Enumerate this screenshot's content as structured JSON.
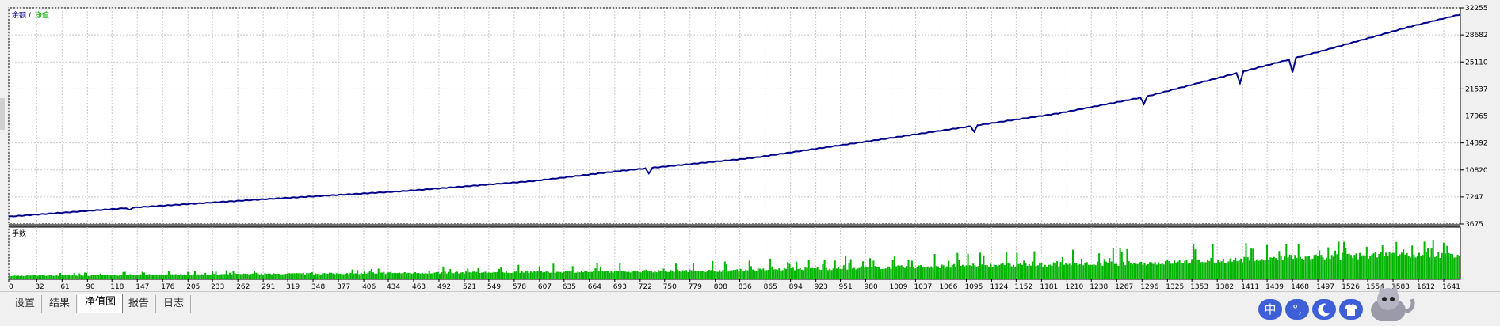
{
  "chart_data": [
    {
      "type": "line",
      "panel": "balance-equity",
      "legend": {
        "balance_label": "余额",
        "separator": "/",
        "equity_label": "净值",
        "placement": "top-left"
      },
      "y_ticks": [
        32255,
        28682,
        25110,
        21537,
        17965,
        14392,
        10820,
        7247,
        3675
      ],
      "ylim": [
        3675,
        32255
      ],
      "xlim": [
        0,
        1660
      ],
      "grid": true,
      "series": [
        {
          "name": "余额",
          "color": "#00008b",
          "points": [
            [
              0,
              4650
            ],
            [
              150,
              5900
            ],
            [
              300,
              7000
            ],
            [
              450,
              8000
            ],
            [
              600,
              9350
            ],
            [
              700,
              10700
            ],
            [
              850,
              12400
            ],
            [
              1000,
              14900
            ],
            [
              1100,
              16600
            ],
            [
              1200,
              18300
            ],
            [
              1300,
              20500
            ],
            [
              1400,
              23500
            ],
            [
              1500,
              26500
            ],
            [
              1600,
              29700
            ],
            [
              1660,
              31400
            ]
          ],
          "dips": [
            [
              138,
              280
            ],
            [
              732,
              700
            ],
            [
              1104,
              800
            ],
            [
              1298,
              900
            ],
            [
              1408,
              1400
            ],
            [
              1468,
              1800
            ]
          ]
        }
      ]
    },
    {
      "type": "bar",
      "panel": "lots",
      "title": "手数",
      "color": "#00b400",
      "x_ticks": [
        0,
        32,
        61,
        90,
        118,
        147,
        176,
        205,
        233,
        262,
        291,
        319,
        348,
        377,
        406,
        434,
        463,
        492,
        521,
        549,
        578,
        607,
        635,
        664,
        693,
        722,
        750,
        779,
        808,
        836,
        865,
        894,
        923,
        951,
        980,
        1009,
        1037,
        1066,
        1095,
        1124,
        1152,
        1181,
        1210,
        1238,
        1267,
        1296,
        1325,
        1353,
        1382,
        1411,
        1439,
        1468,
        1497,
        1526,
        1554,
        1583,
        1612,
        1641
      ],
      "base_fill": [
        [
          0,
          0.08
        ],
        [
          400,
          0.14
        ],
        [
          800,
          0.2
        ],
        [
          1100,
          0.32
        ],
        [
          1300,
          0.38
        ],
        [
          1500,
          0.52
        ],
        [
          1660,
          0.6
        ]
      ],
      "spike_fill": [
        [
          0,
          0.14
        ],
        [
          400,
          0.26
        ],
        [
          800,
          0.45
        ],
        [
          1100,
          0.65
        ],
        [
          1300,
          0.8
        ],
        [
          1660,
          1.0
        ]
      ]
    }
  ],
  "tabs": [
    {
      "label": "设置"
    },
    {
      "label": "结果"
    },
    {
      "label": "净值图"
    },
    {
      "label": "报告"
    },
    {
      "label": "日志"
    }
  ],
  "tray": [
    {
      "label": "中",
      "color": "#3f5fd8"
    },
    {
      "label": "°,",
      "color": "#3f5fd8"
    },
    {
      "icon": "moon-icon",
      "color": "#3f5fd8"
    },
    {
      "icon": "shirt-icon",
      "color": "#3f5fd8"
    }
  ],
  "colors": {
    "plot_bg": "#ffffff",
    "grid": "#c8c8c8",
    "axis": "#000000",
    "divider": "#6e6e6e"
  }
}
